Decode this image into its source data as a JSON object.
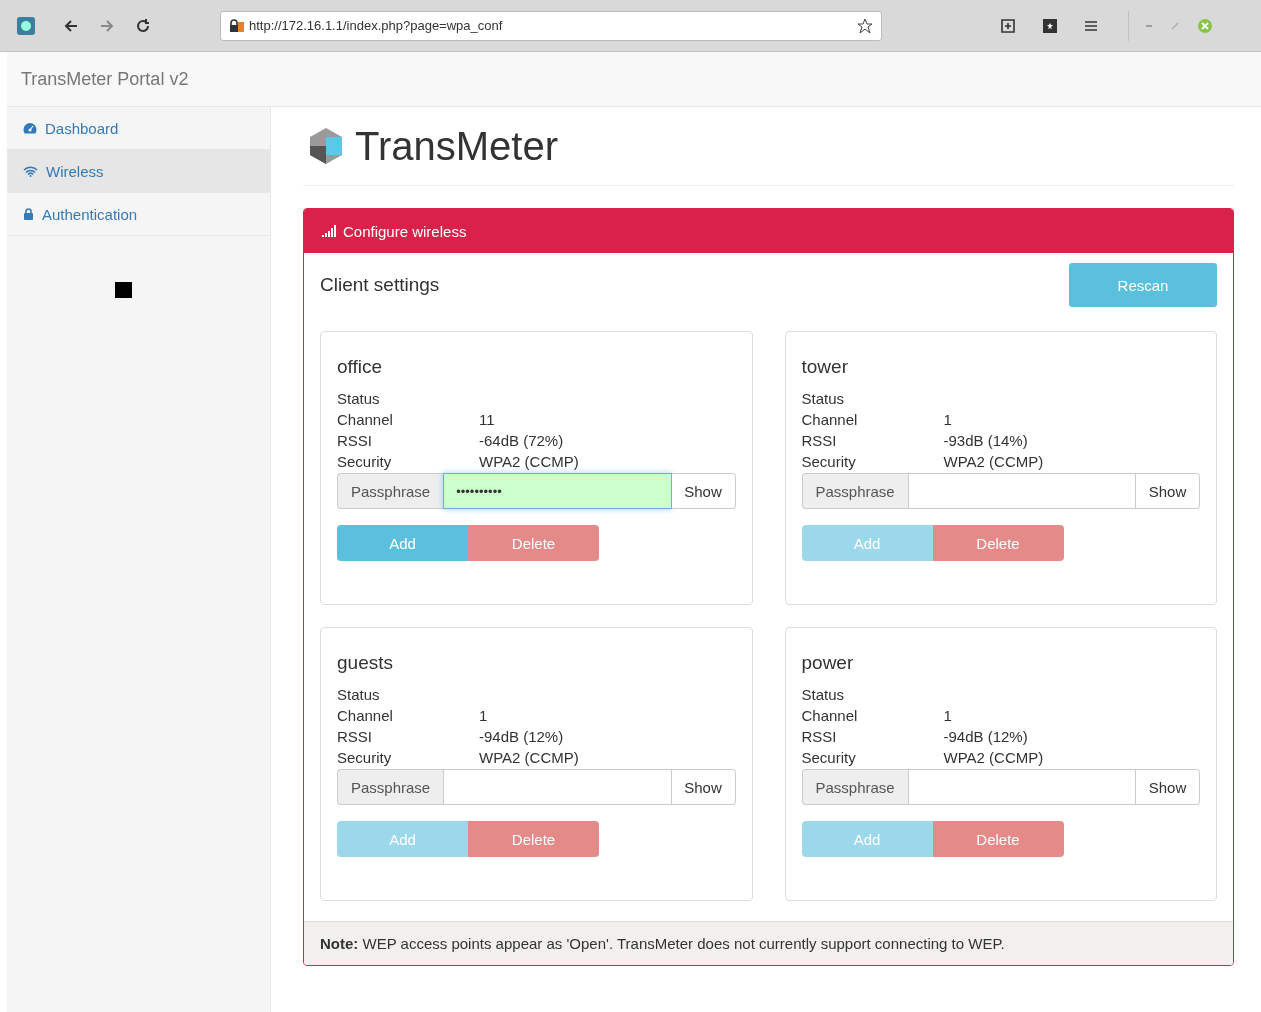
{
  "browser": {
    "url": "http://172.16.1.1/index.php?page=wpa_conf"
  },
  "navbar": {
    "brand": "TransMeter Portal v2"
  },
  "sidebar": {
    "items": [
      {
        "label": "Dashboard",
        "kind": "dashboard",
        "selected": false
      },
      {
        "label": "Wireless",
        "kind": "wireless",
        "selected": true
      },
      {
        "label": "Authentication",
        "kind": "lock",
        "selected": false
      }
    ]
  },
  "page_title": "TransMeter",
  "panel": {
    "title": "Configure wireless",
    "section_title": "Client settings",
    "rescan_button": "Rescan",
    "networks": [
      {
        "name": "office",
        "rows": [
          {
            "label": "Status"
          },
          {
            "label": "Channel",
            "value": "11"
          },
          {
            "label": "RSSI",
            "value": "-64dB (72%)"
          },
          {
            "label": "Security",
            "value": "WPA2 (CCMP)"
          }
        ],
        "field_label": "Passphrase",
        "value": "••••••••••",
        "focused": true,
        "show_button": "Show",
        "add_button": "Add",
        "add_disabled": false,
        "delete_button": "Delete"
      },
      {
        "name": "tower",
        "rows": [
          {
            "label": "Status"
          },
          {
            "label": "Channel",
            "value": "1"
          },
          {
            "label": "RSSI",
            "value": "-93dB (14%)"
          },
          {
            "label": "Security",
            "value": "WPA2 (CCMP)"
          }
        ],
        "field_label": "Passphrase",
        "focused": false,
        "show_button": "Show",
        "add_button": "Add",
        "add_disabled": true,
        "delete_button": "Delete"
      },
      {
        "name": "guests",
        "rows": [
          {
            "label": "Status"
          },
          {
            "label": "Channel",
            "value": "1"
          },
          {
            "label": "RSSI",
            "value": "-94dB (12%)"
          },
          {
            "label": "Security",
            "value": "WPA2 (CCMP)"
          }
        ],
        "field_label": "Passphrase",
        "focused": false,
        "show_button": "Show",
        "add_button": "Add",
        "add_disabled": true,
        "delete_button": "Delete"
      },
      {
        "name": "power",
        "rows": [
          {
            "label": "Status"
          },
          {
            "label": "Channel",
            "value": "1"
          },
          {
            "label": "RSSI",
            "value": "-94dB (12%)"
          },
          {
            "label": "Security",
            "value": "WPA2 (CCMP)"
          }
        ],
        "field_label": "Passphrase",
        "focused": false,
        "show_button": "Show",
        "add_button": "Add",
        "add_disabled": true,
        "delete_button": "Delete"
      }
    ],
    "note": "**Note:** WEP access points appear as 'Open'. TransMeter does not currently support connecting to WEP."
  }
}
